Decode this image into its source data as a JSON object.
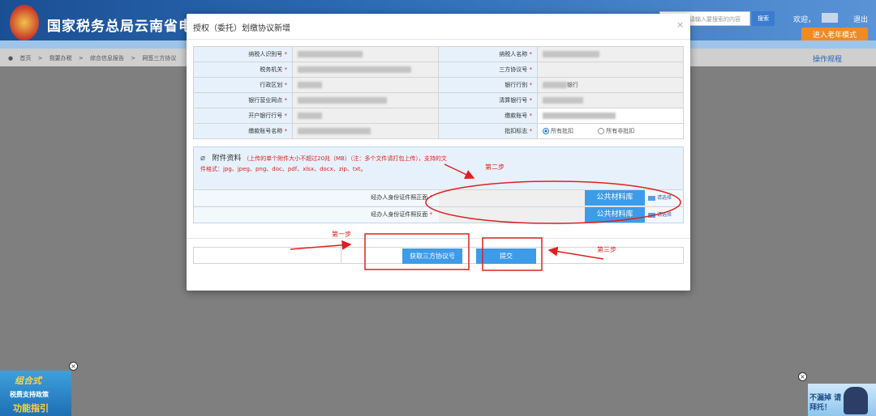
{
  "header": {
    "site_title": "国家税务总局云南省电",
    "search_placeholder": "请输入要搜索的内容",
    "search_button": "搜索",
    "welcome": "欢迎，",
    "logout": "退出",
    "elder_mode": "进入老年模式"
  },
  "breadcrumb": [
    "首页",
    ">",
    "我要办税",
    ">",
    "综合信息报告",
    ">",
    "网签三方协议"
  ],
  "rules_link": "操作规程",
  "modal": {
    "title": "授权（委托）划缴协议新增",
    "close": "×",
    "rows": [
      {
        "l1": "纳税人识别号",
        "l2": "纳税人名称"
      },
      {
        "l1": "税务机关",
        "l2": "三方协议号"
      },
      {
        "l1": "行政区划",
        "l2": "银行行别",
        "v2": "银行"
      },
      {
        "l1": "银行营业网点",
        "l2": "清算银行号"
      },
      {
        "l1": "开户银行行号",
        "l2": "缴款账号"
      },
      {
        "l1": "缴款账号名称",
        "l2": "批扣标志"
      }
    ],
    "req_mark": "*",
    "radio_all": "所有批扣",
    "radio_none": "所有非批扣",
    "attach": {
      "title": "附件资料",
      "note": "（上传的单个附件大小不超过20兆（MB）（注：多个文件请打包上传），支持的文件格式：jpg、jpeg、png、doc、pdf、xlsx、docx、zip、txt。",
      "row1_label": "经办人身份证件照正面",
      "row2_label": "经办人身份证件照反面",
      "lib_button": "公共材料库",
      "choose": "请选择"
    },
    "get_button": "获取三方协议号",
    "submit_button": "提交"
  },
  "annotations": {
    "step1": "第一步",
    "step2": "第二步",
    "step3": "第三步"
  },
  "ads": {
    "left_line1": "组合式",
    "left_line2": "税费支持政策",
    "left_line3": "功能指引",
    "right_text": "不漏掉 请拜托！",
    "close": "×"
  },
  "colors": {
    "accent": "#3e9be8",
    "annotation": "#e02020",
    "overlay": "#7f7f7f"
  }
}
